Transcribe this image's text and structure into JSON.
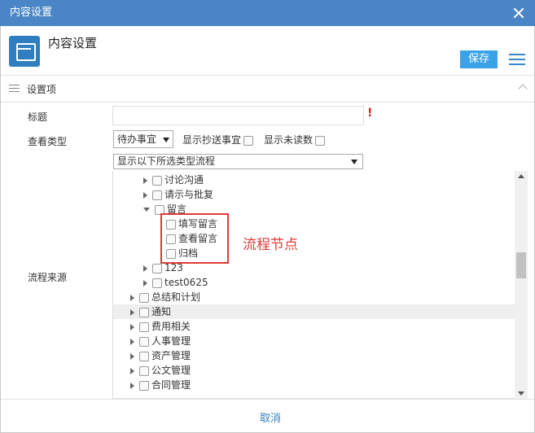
{
  "window": {
    "title": "内容设置"
  },
  "header": {
    "title": "内容设置",
    "save_label": "保存"
  },
  "section": {
    "label": "设置项"
  },
  "form": {
    "title_label": "标题",
    "title_value": "",
    "required_mark": "!",
    "view_type_label": "查看类型",
    "view_type_value": "待办事宜",
    "show_cc_label": "显示抄送事宜",
    "show_unread_label": "显示未读数",
    "source_label": "流程来源",
    "source_filter_value": "显示以下所选类型流程"
  },
  "tree": [
    {
      "label": "讨论沟通",
      "level": 2,
      "expanded": false
    },
    {
      "label": "请示与批复",
      "level": 2,
      "expanded": false
    },
    {
      "label": "留言",
      "level": 2,
      "expanded": true
    },
    {
      "label": "填写留言",
      "level": 3
    },
    {
      "label": "查看留言",
      "level": 3
    },
    {
      "label": "归档",
      "level": 3
    },
    {
      "label": "123",
      "level": 2,
      "expanded": false
    },
    {
      "label": "test0625",
      "level": 2,
      "expanded": false
    },
    {
      "label": "总结和计划",
      "level": 1,
      "expanded": false
    },
    {
      "label": "通知",
      "level": 1,
      "expanded": false,
      "highlighted": true
    },
    {
      "label": "费用相关",
      "level": 1,
      "expanded": false
    },
    {
      "label": "人事管理",
      "level": 1,
      "expanded": false
    },
    {
      "label": "资产管理",
      "level": 1,
      "expanded": false
    },
    {
      "label": "公文管理",
      "level": 1,
      "expanded": false
    },
    {
      "label": "合同管理",
      "level": 1,
      "expanded": false
    }
  ],
  "annotation": {
    "text": "流程节点",
    "color": "#e03a3a"
  },
  "footer": {
    "cancel_label": "取消"
  },
  "colors": {
    "titlebar": "#4a86c5",
    "accent": "#3aa3e8"
  }
}
